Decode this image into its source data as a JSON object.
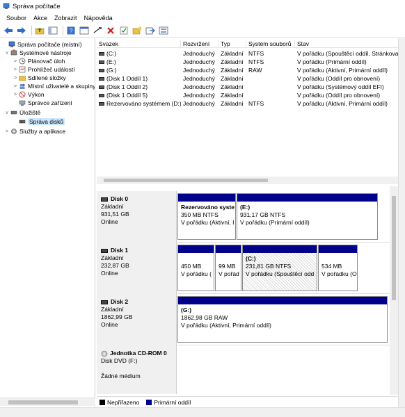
{
  "window": {
    "title": "Správa počítače"
  },
  "menu": [
    "Soubor",
    "Akce",
    "Zobrazit",
    "Nápověda"
  ],
  "toolbar": [
    "back-icon",
    "forward-icon",
    "folder-up-icon",
    "console-tree-icon",
    "help-icon",
    "properties-icon",
    "connect-icon",
    "delete-icon",
    "check-icon",
    "new-folder-icon",
    "export-icon",
    "view-icon"
  ],
  "tree": [
    {
      "label": "Správa počítače (místní)",
      "icon": "computer-icon",
      "exp": "",
      "indent": 0
    },
    {
      "label": "Systémové nástroje",
      "icon": "tools-icon",
      "exp": "v",
      "indent": 1
    },
    {
      "label": "Plánovač úloh",
      "icon": "clock-icon",
      "exp": ">",
      "indent": 2
    },
    {
      "label": "Prohlížeč událostí",
      "icon": "event-icon",
      "exp": ">",
      "indent": 2
    },
    {
      "label": "Sdílené složky",
      "icon": "folder-icon",
      "exp": ">",
      "indent": 2
    },
    {
      "label": "Místní uživatelé a skupiny",
      "icon": "users-icon",
      "exp": ">",
      "indent": 2
    },
    {
      "label": "Výkon",
      "icon": "performance-icon",
      "exp": ">",
      "indent": 2
    },
    {
      "label": "Správce zařízení",
      "icon": "device-icon",
      "exp": "",
      "indent": 2
    },
    {
      "label": "Úložiště",
      "icon": "storage-icon",
      "exp": "v",
      "indent": 1
    },
    {
      "label": "Správa disků",
      "icon": "disk-icon",
      "exp": "",
      "indent": 2,
      "selected": true
    },
    {
      "label": "Služby a aplikace",
      "icon": "services-icon",
      "exp": ">",
      "indent": 1
    }
  ],
  "table": {
    "columns": [
      "Svazek",
      "Rozvržení",
      "Typ",
      "Systém souborů",
      "Stav"
    ],
    "rows": [
      [
        "(C:)",
        "Jednoduchý",
        "Základní",
        "NTFS",
        "V pořádku (Spouštěcí oddíl, Stránkovací"
      ],
      [
        "(E:)",
        "Jednoduchý",
        "Základní",
        "NTFS",
        "V pořádku (Primární oddíl)"
      ],
      [
        "(G:)",
        "Jednoduchý",
        "Základní",
        "RAW",
        "V pořádku (Aktivní, Primární oddíl)"
      ],
      [
        "(Disk 1 Oddíl 1)",
        "Jednoduchý",
        "Základní",
        "",
        "V pořádku (Oddíl pro obnovení)"
      ],
      [
        "(Disk 1 Oddíl 2)",
        "Jednoduchý",
        "Základní",
        "",
        "V pořádku (Systémový oddíl EFI)"
      ],
      [
        "(Disk 1 Oddíl 5)",
        "Jednoduchý",
        "Základní",
        "",
        "V pořádku (Oddíl pro obnovení)"
      ],
      [
        "Rezervováno systémem (D:)",
        "Jednoduchý",
        "Základní",
        "NTFS",
        "V pořádku (Aktivní, Primární oddíl)"
      ]
    ]
  },
  "disks": [
    {
      "name": "Disk 0",
      "type": "Základní",
      "size": "931,51 GB",
      "status": "Online",
      "parts": [
        {
          "title": "Rezervováno syste",
          "size": "350 MB NTFS",
          "status": "V pořádku (Aktivní, I"
        },
        {
          "title": "(E:)",
          "size": "931,17 GB NTFS",
          "status": "V pořádku (Primární oddíl)"
        }
      ]
    },
    {
      "name": "Disk 1",
      "type": "Základní",
      "size": "232,87 GB",
      "status": "Online",
      "parts": [
        {
          "title": "",
          "size": "450 MB",
          "status": "V pořádku ("
        },
        {
          "title": "",
          "size": "99 MB",
          "status": "V pořád"
        },
        {
          "title": "(C:)",
          "size": "231,81 GB NTFS",
          "status": "V pořádku (Spouštěcí odd"
        },
        {
          "title": "",
          "size": "534 MB",
          "status": "V pořádku (O"
        }
      ]
    },
    {
      "name": "Disk 2",
      "type": "Základní",
      "size": "1862,99 GB",
      "status": "Online",
      "parts": [
        {
          "title": "(G:)",
          "size": "1862,98 GB RAW",
          "status": "V pořádku (Aktivní, Primární oddíl)"
        }
      ]
    },
    {
      "name": "Jednotka CD-ROM 0",
      "type": "Disk DVD (F:)",
      "size": "",
      "status": "Žádné médium",
      "parts": []
    }
  ],
  "legend": [
    {
      "label": "Nepřiřazeno",
      "color": "#000000"
    },
    {
      "label": "Primární oddíl",
      "color": "#00008b"
    }
  ]
}
